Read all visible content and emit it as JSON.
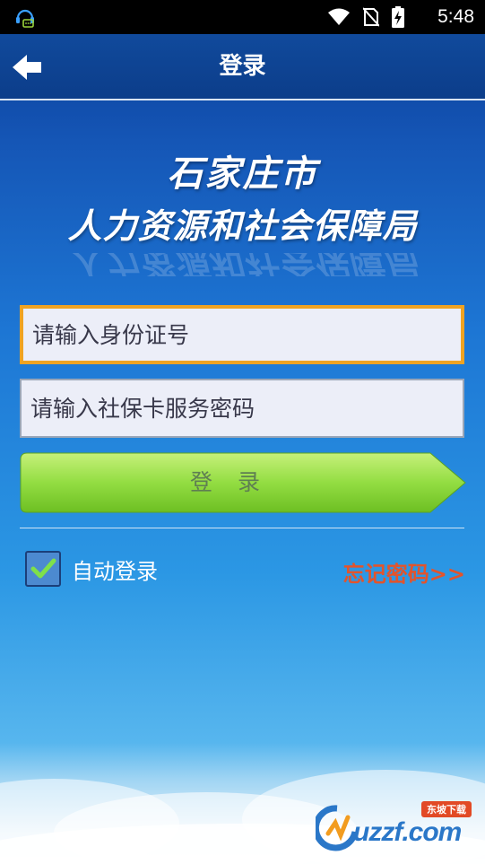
{
  "status_bar": {
    "time": "5:48",
    "icons": [
      "headset-notification-icon",
      "wifi-icon",
      "no-sim-icon",
      "battery-charging-icon"
    ]
  },
  "title_bar": {
    "title": "登录",
    "back_icon": "arrow-left-icon"
  },
  "logo": {
    "city": "石家庄市",
    "bureau": "人力资源和社会保障局"
  },
  "form": {
    "id_placeholder": "请输入身份证号",
    "password_placeholder": "请输入社保卡服务密码",
    "login_label": "登录",
    "auto_login_label": "自动登录",
    "auto_login_checked": true,
    "forgot_password": "忘记密码>>"
  },
  "watermark": {
    "text": "uzzf.com",
    "tag": "东坡下载"
  },
  "colors": {
    "focus_border": "#efa322",
    "login_button": "#8fd93c",
    "forgot_link": "#e2542c",
    "title_bar": "#0c3d8a"
  }
}
